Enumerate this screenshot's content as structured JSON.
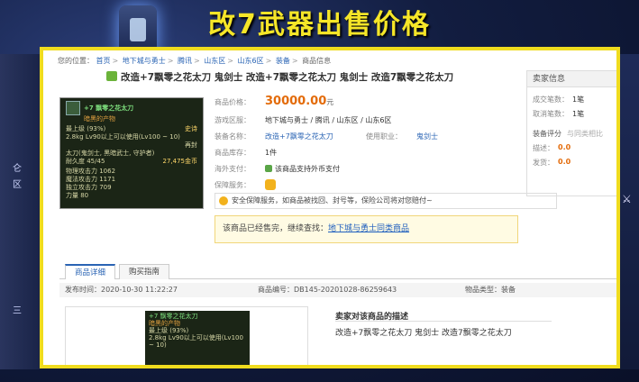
{
  "overlay_title": "改7武器出售价格",
  "breadcrumb": {
    "prefix": "您的位置：",
    "items": [
      "首页",
      "地下城与勇士",
      "腾讯",
      "山东区",
      "山东6区",
      "装备",
      "商品信息"
    ]
  },
  "product_title": "改造+7飘零之花太刀 鬼剑士 改造+7飘零之花太刀 鬼剑士 改造7飘零之花太刀",
  "thumbnail": {
    "name": "+7 飘零之花太刀",
    "sub": "暗黑的产物",
    "lines": [
      "最上级  (93%)",
      "2.8kg  Lv90以上可以使用(Lv100 ~ 10)",
      "再封",
      "太刀(鬼剑士, 黑暗武士, 守护者)",
      "耐久度 45/45",
      "物理攻击力 1062",
      "魔法攻击力 1171",
      "独立攻击力 709",
      "力量 80"
    ],
    "right_label": "史诗",
    "gold": "27,475金币"
  },
  "details": {
    "price_label": "商品价格：",
    "price": "30000.00",
    "price_unit": "元",
    "server_label": "游戏区服：",
    "server": "地下城与勇士 / 腾讯 / 山东区 / 山东6区",
    "equip_label": "装备名称：",
    "equip": "改造+7飘零之花太刀",
    "job_label": "使用职业：",
    "job": "鬼剑士",
    "stock_label": "商品库存：",
    "stock": "1件",
    "overseas_label": "海外支付：",
    "overseas": "该商品支持外币支付",
    "guarantee_label": "保障服务："
  },
  "warning": "安全保障服务，如商品被找回、封号等，保险公司将对您赔付~",
  "sold_notice": {
    "text": "该商品已经售完，继续查找：",
    "link": "地下城与勇士同类商品"
  },
  "seller": {
    "title": "卖家信息",
    "deal_label": "成交笔数：",
    "deal": "1笔",
    "cancel_label": "取消笔数：",
    "cancel": "1笔",
    "rating_title": "装备评分",
    "rating_hint": "与同类相比",
    "desc_label": "描述：",
    "desc": "0.0",
    "ship_label": "发货：",
    "ship": "0.0"
  },
  "tabs": [
    "商品详细",
    "购买指南"
  ],
  "meta": {
    "published": "发布时间：2020-10-30 11:22:27",
    "number": "商品编号：DB145-20201028-86259643",
    "type": "物品类型：装备"
  },
  "description": {
    "heading": "卖家对该商品的描述",
    "text": "改造+7飘零之花太刀 鬼剑士 改造7飘零之花太刀"
  },
  "side_text": {
    "left": [
      "仑",
      "区",
      "三"
    ]
  }
}
